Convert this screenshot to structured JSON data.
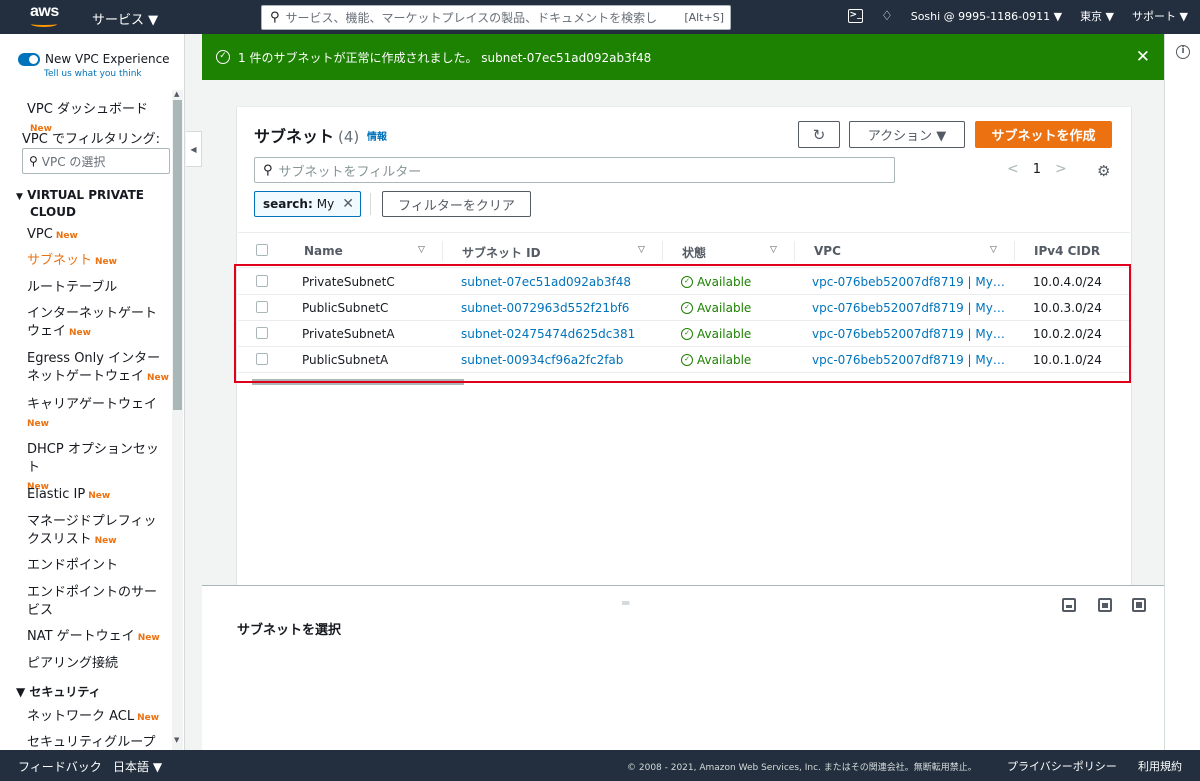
{
  "topbar": {
    "logo": "aws",
    "services_label": "サービス ▼",
    "search_placeholder": "サービス、機能、マーケットプレイスの製品、ドキュメントを検索し",
    "search_shortcut": "[Alt+S]",
    "account_label": "Soshi @ 9995-1186-0911 ▼",
    "region_label": "東京 ▼",
    "support_label": "サポート ▼",
    "icons": [
      "cloudshell-icon",
      "bell-icon",
      "search-icon"
    ]
  },
  "sidebar": {
    "toggle_label": "New VPC Experience",
    "toggle_sub": "Tell us what you think",
    "dashboard_label": "VPC ダッシュボード",
    "filter_label": "VPC でフィルタリング:",
    "vpc_select_placeholder": "VPC の選択",
    "section_vpc_line1": "VIRTUAL PRIVATE",
    "section_vpc_line2": "CLOUD",
    "section_security": "▼ セキュリティ",
    "new_badge": "New",
    "items": [
      {
        "label": "VPC",
        "badge": "New"
      },
      {
        "label": "サブネット",
        "badge": "New"
      },
      {
        "label": "ルートテーブル",
        "badge": ""
      },
      {
        "label": "インターネットゲートウェイ",
        "badge": "New"
      },
      {
        "label": "Egress Only インターネットゲートウェイ",
        "badge": "New"
      },
      {
        "label": "キャリアゲートウェイ",
        "badge": "New"
      },
      {
        "label": "DHCP オプションセット",
        "badge": "New"
      },
      {
        "label": "Elastic IP",
        "badge": "New"
      },
      {
        "label": "マネージドプレフィックスリスト",
        "badge": "New"
      },
      {
        "label": "エンドポイント",
        "badge": ""
      },
      {
        "label": "エンドポイントのサービス",
        "badge": ""
      },
      {
        "label": "NAT ゲートウェイ",
        "badge": "New"
      },
      {
        "label": "ピアリング接続",
        "badge": ""
      },
      {
        "label": "ネットワーク ACL",
        "badge": "New"
      },
      {
        "label": "セキュリティグループ",
        "badge": ""
      }
    ]
  },
  "flash": {
    "message": "1 件のサブネットが正常に作成されました。 subnet-07ec51ad092ab3f48"
  },
  "card": {
    "title": "サブネット",
    "count": "(4)",
    "info": "情報",
    "actions_label": "アクション ▼",
    "create_label": "サブネットを作成",
    "filter_placeholder": "サブネットをフィルター",
    "page": "1",
    "token_key": "search:",
    "token_value": "My",
    "clear_label": "フィルターをクリア",
    "columns": [
      "Name",
      "サブネット ID",
      "状態",
      "VPC",
      "IPv4 CIDR"
    ],
    "rows": [
      {
        "name": "PrivateSubnetC",
        "id": "subnet-07ec51ad092ab3f48",
        "state": "Available",
        "vpc": "vpc-076beb52007df8719 | My…",
        "cidr": "10.0.4.0/24"
      },
      {
        "name": "PublicSubnetC",
        "id": "subnet-0072963d552f21bf6",
        "state": "Available",
        "vpc": "vpc-076beb52007df8719 | My…",
        "cidr": "10.0.3.0/24"
      },
      {
        "name": "PrivateSubnetA",
        "id": "subnet-02475474d625dc381",
        "state": "Available",
        "vpc": "vpc-076beb52007df8719 | My…",
        "cidr": "10.0.2.0/24"
      },
      {
        "name": "PublicSubnetA",
        "id": "subnet-00934cf96a2fc2fab",
        "state": "Available",
        "vpc": "vpc-076beb52007df8719 | My…",
        "cidr": "10.0.1.0/24"
      }
    ]
  },
  "split_panel": {
    "title": "サブネットを選択"
  },
  "footer": {
    "feedback": "フィードバック",
    "language": "日本語 ▼",
    "copyright": "© 2008 - 2021, Amazon Web Services, Inc. またはその関連会社。無断転用禁止。",
    "privacy": "プライバシーポリシー",
    "terms": "利用規約"
  },
  "colors": {
    "nav_dark": "#232f3e",
    "accent_orange": "#ec7211",
    "success_green": "#1d8102",
    "link_blue": "#0073bb",
    "highlight_red": "#e0001b"
  }
}
